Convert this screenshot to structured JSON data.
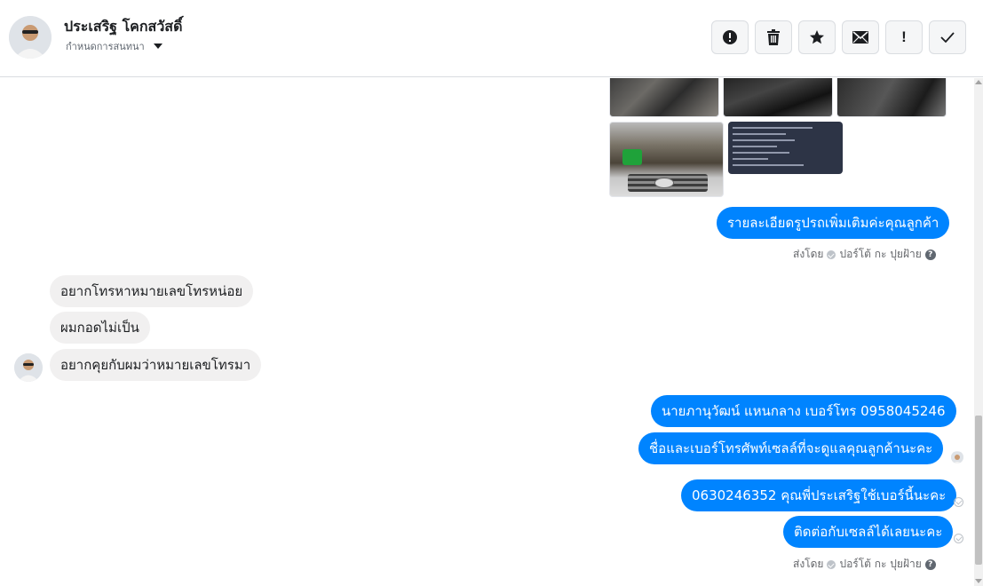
{
  "header": {
    "contact_name": "ประเสริฐ โคกสวัสดิ์",
    "assign_label": "กำหนดการสนทนา",
    "actions": [
      {
        "name": "spam-button",
        "icon": "alert-circle-icon"
      },
      {
        "name": "delete-button",
        "icon": "trash-icon"
      },
      {
        "name": "star-button",
        "icon": "star-icon"
      },
      {
        "name": "mark-unread-button",
        "icon": "envelope-icon"
      },
      {
        "name": "follow-up-button",
        "icon": "exclamation-icon",
        "glyph": "!"
      },
      {
        "name": "mark-done-button",
        "icon": "check-icon"
      }
    ]
  },
  "messages": {
    "out_1": "รายละเอียดรูปรถเพิ่มเติมค่ะคุณลูกค้า",
    "sent_by_1": {
      "prefix": "ส่งโดย",
      "agent": "ปอร์โต้ กะ ปุยฝ้าย",
      "help": "?"
    },
    "in_1": "อยากโทรหาหมายเลขโทรหน่อย",
    "in_2": "ผมกอดไม่เป็น",
    "in_3": "อยากคุยกับผมว่าหมายเลขโทรมา",
    "out_2": "นายภานุวัฒน์ แหนกลาง เบอร์โทร 0958045246",
    "out_3": "ชื่อและเบอร์โทรศัพท์เซลล์ที่จะดูแลคุณลูกค้านะคะ",
    "out_4": "0630246352 คุณพี่ประเสริฐใช้เบอร์นี้นะคะ",
    "out_5": "ติดต่อกับเซลล์ได้เลยนะคะ",
    "sent_by_2": {
      "prefix": "ส่งโดย",
      "agent": "ปอร์โต้ กะ ปุยฝ้าย",
      "help": "?"
    }
  },
  "colors": {
    "outgoing_bubble": "#0084ff",
    "incoming_bubble": "#f1f0f0",
    "header_border": "#dadde1"
  }
}
